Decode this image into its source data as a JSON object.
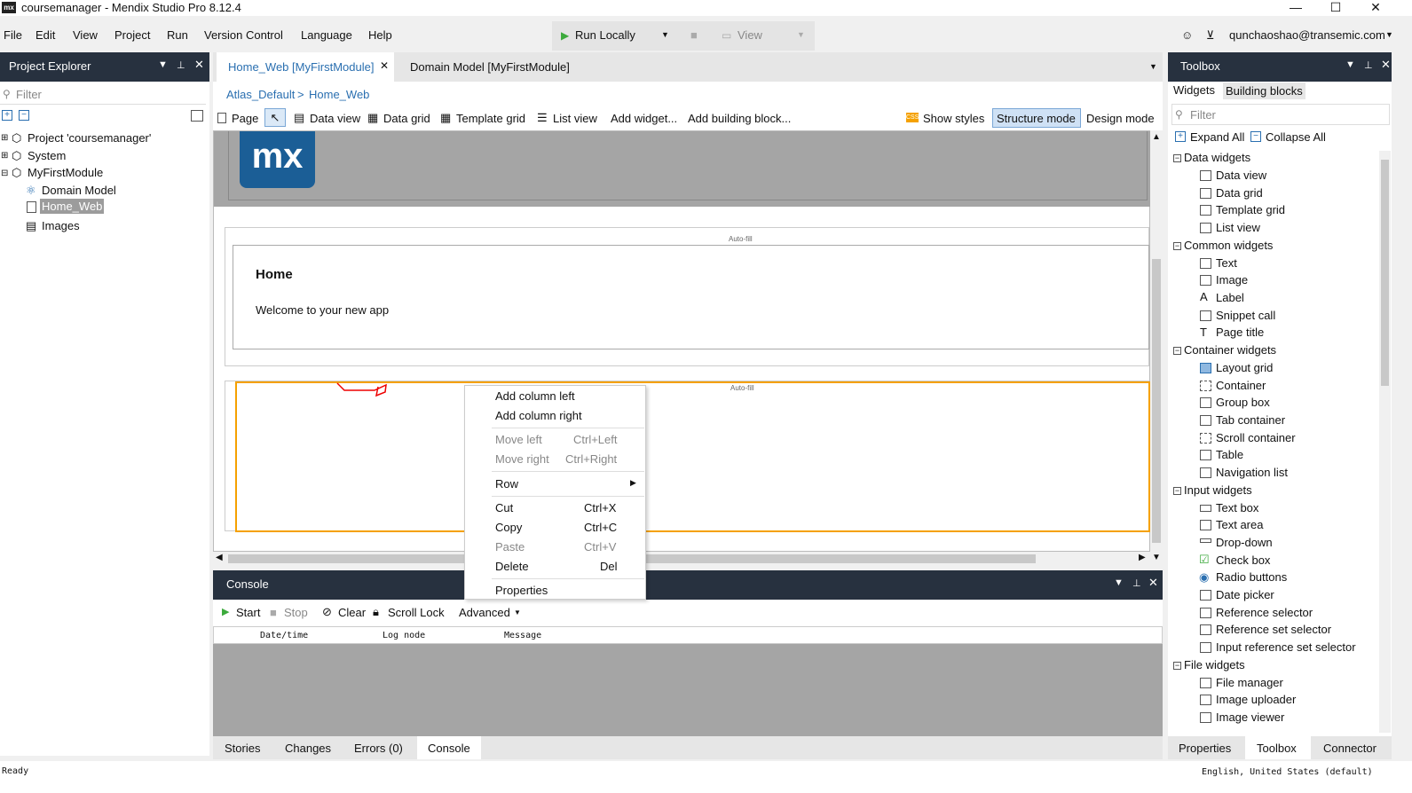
{
  "window": {
    "title": "coursemanager - Mendix Studio Pro 8.12.4",
    "logo_text": "mx",
    "min_icon": "minimize-icon",
    "max_icon": "maximize-icon",
    "close_icon": "close-icon"
  },
  "menu": [
    "File",
    "Edit",
    "View",
    "Project",
    "Run",
    "Version Control",
    "Language",
    "Help"
  ],
  "run": {
    "run_locally": "Run Locally",
    "view": "View"
  },
  "user": {
    "email": "qunchaoshao@transemic.com"
  },
  "project_explorer": {
    "title": "Project Explorer",
    "filter_placeholder": "Filter",
    "items": [
      {
        "label": "Project 'coursemanager'"
      },
      {
        "label": "System"
      },
      {
        "label": "MyFirstModule"
      },
      {
        "label": "Domain Model"
      },
      {
        "label": "Home_Web"
      },
      {
        "label": "Images"
      }
    ]
  },
  "tabs": {
    "active": "Home_Web [MyFirstModule]",
    "other": "Domain Model [MyFirstModule]"
  },
  "breadcrumb": {
    "layout": "Atlas_Default",
    "sep": ">",
    "page": "Home_Web"
  },
  "page_toolbar": {
    "page": "Page",
    "data_view": "Data view",
    "data_grid": "Data grid",
    "template_grid": "Template grid",
    "list_view": "List view",
    "add_widget": "Add widget...",
    "add_building_block": "Add building block...",
    "show_styles": "Show styles",
    "structure_mode": "Structure mode",
    "design_mode": "Design mode"
  },
  "canvas": {
    "logo": "mx",
    "autofill1": "Auto-fill",
    "autofill2": "Auto-fill",
    "home_heading": "Home",
    "welcome": "Welcome to your new app"
  },
  "context_menu": {
    "items": [
      {
        "label": "Add column left",
        "shortcut": ""
      },
      {
        "label": "Add column right",
        "shortcut": ""
      },
      {
        "label": "Move left",
        "shortcut": "Ctrl+Left"
      },
      {
        "label": "Move right",
        "shortcut": "Ctrl+Right"
      },
      {
        "label": "Row",
        "shortcut": ""
      },
      {
        "label": "Cut",
        "shortcut": "Ctrl+X"
      },
      {
        "label": "Copy",
        "shortcut": "Ctrl+C"
      },
      {
        "label": "Paste",
        "shortcut": "Ctrl+V"
      },
      {
        "label": "Delete",
        "shortcut": "Del"
      },
      {
        "label": "Properties",
        "shortcut": ""
      }
    ]
  },
  "console": {
    "title": "Console",
    "start": "Start",
    "stop": "Stop",
    "clear": "Clear",
    "scroll_lock": "Scroll Lock",
    "advanced": "Advanced",
    "columns": [
      "Date/time",
      "Log node",
      "Message"
    ]
  },
  "bottom_tabs": [
    "Stories",
    "Changes",
    "Errors (0)",
    "Console"
  ],
  "status": {
    "left": "Ready",
    "right": "English, United States (default)"
  },
  "toolbox": {
    "title": "Toolbox",
    "tab_widgets": "Widgets",
    "tab_building_blocks": "Building blocks",
    "filter_placeholder": "Filter",
    "expand_all": "Expand All",
    "collapse_all": "Collapse All",
    "categories": [
      {
        "name": "Data widgets",
        "items": [
          "Data view",
          "Data grid",
          "Template grid",
          "List view"
        ]
      },
      {
        "name": "Common widgets",
        "items": [
          "Text",
          "Image",
          "Label",
          "Snippet call",
          "Page title"
        ]
      },
      {
        "name": "Container widgets",
        "items": [
          "Layout grid",
          "Container",
          "Group box",
          "Tab container",
          "Scroll container",
          "Table",
          "Navigation list"
        ]
      },
      {
        "name": "Input widgets",
        "items": [
          "Text box",
          "Text area",
          "Drop-down",
          "Check box",
          "Radio buttons",
          "Date picker",
          "Reference selector",
          "Reference set selector",
          "Input reference set selector"
        ]
      },
      {
        "name": "File widgets",
        "items": [
          "File manager",
          "Image uploader",
          "Image viewer"
        ]
      }
    ],
    "bottom_tabs": [
      "Properties",
      "Toolbox",
      "Connector"
    ]
  },
  "colors": {
    "panel_header": "#27313f",
    "accent_orange": "#f5a100",
    "link_blue": "#2a6fb0",
    "mx_blue": "#1b5e96"
  }
}
